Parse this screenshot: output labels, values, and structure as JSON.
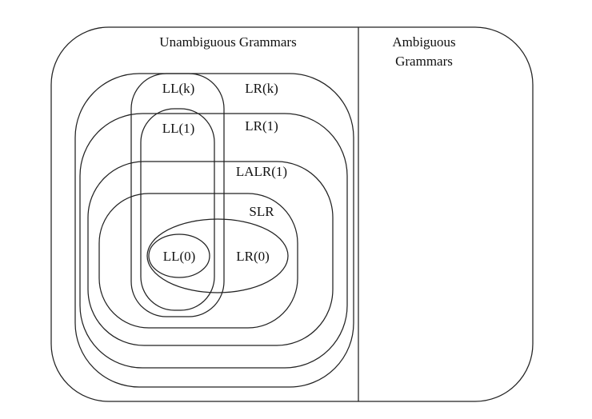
{
  "labels": {
    "unambiguous": "Unambiguous Grammars",
    "ambiguous_line1": "Ambiguous",
    "ambiguous_line2": "Grammars",
    "llk": "LL(k)",
    "lrk": "LR(k)",
    "ll1": "LL(1)",
    "lr1": "LR(1)",
    "lalr1": "LALR(1)",
    "slr": "SLR",
    "ll0": "LL(0)",
    "lr0": "LR(0)"
  },
  "colors": {
    "stroke": "#222222",
    "text": "#111111",
    "background": "#ffffff"
  }
}
